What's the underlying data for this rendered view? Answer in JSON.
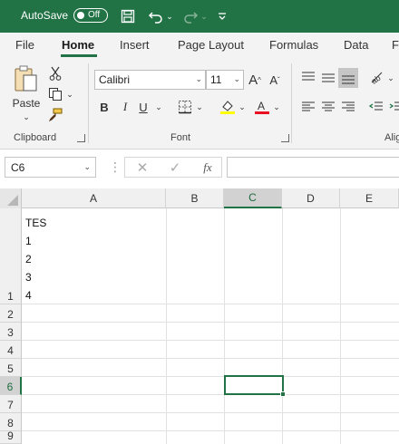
{
  "titlebar": {
    "autosave_label": "AutoSave",
    "autosave_state": "Off"
  },
  "tabs": [
    {
      "label": "File"
    },
    {
      "label": "Home",
      "active": true
    },
    {
      "label": "Insert"
    },
    {
      "label": "Page Layout"
    },
    {
      "label": "Formulas"
    },
    {
      "label": "Data"
    },
    {
      "label": "F"
    }
  ],
  "ribbon": {
    "clipboard": {
      "paste_label": "Paste",
      "group_label": "Clipboard"
    },
    "font": {
      "font_name": "Calibri",
      "font_size": "11",
      "bold": "B",
      "italic": "I",
      "underline": "U",
      "group_label": "Font",
      "highlight_color": "#ffff00",
      "font_color": "#e81123"
    },
    "alignment": {
      "group_label": "Alig"
    }
  },
  "formula_bar": {
    "name_box": "C6",
    "fx_label": "fx",
    "value": ""
  },
  "grid": {
    "columns": [
      "A",
      "B",
      "C",
      "D",
      "E"
    ],
    "selected_column": "C",
    "rows": [
      "1",
      "2",
      "3",
      "4",
      "5",
      "6",
      "7",
      "8",
      "9"
    ],
    "selected_row": "6",
    "cell_a1_lines": [
      "TES",
      "1",
      "2",
      "3",
      "4"
    ]
  },
  "colors": {
    "accent": "#217346"
  }
}
